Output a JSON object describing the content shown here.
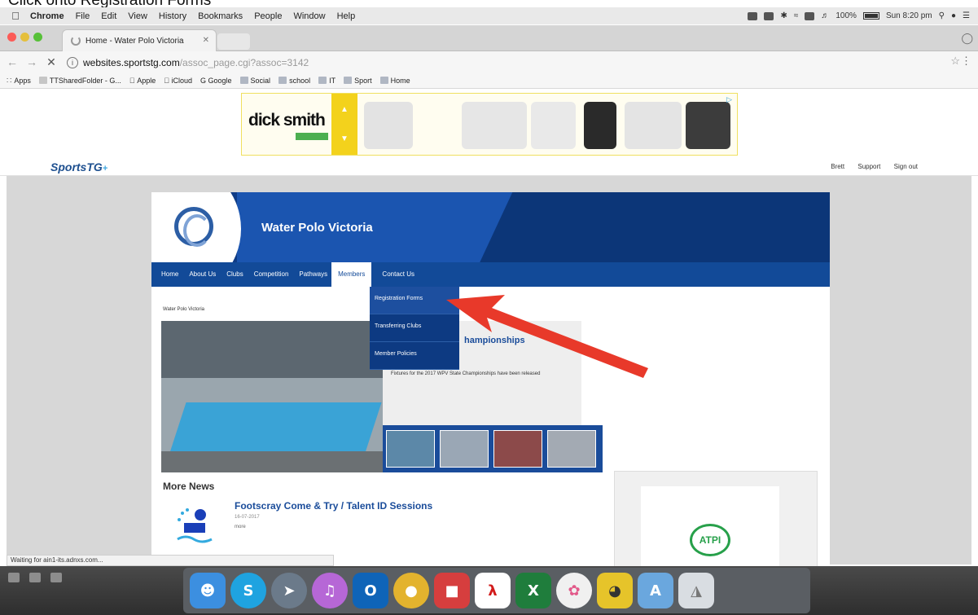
{
  "caption": "Click onto Registration Forms",
  "menubar": {
    "items": [
      "Chrome",
      "File",
      "Edit",
      "View",
      "History",
      "Bookmarks",
      "People",
      "Window",
      "Help"
    ],
    "battery": "100%",
    "clock": "Sun 8:20 pm"
  },
  "browser": {
    "tab_title": "Home - Water Polo Victoria",
    "url_host": "websites.sportstg.com",
    "url_path": "/assoc_page.cgi?assoc=3142",
    "bookmarks": [
      "Apps",
      "TTSharedFolder - G...",
      "Apple",
      "iCloud",
      "Google",
      "Social",
      "school",
      "IT",
      "Sport",
      "Home"
    ],
    "status": "Waiting for ain1-its.adnxs.com..."
  },
  "ad": {
    "brand": "dick smith",
    "brand_sub": ".com.au"
  },
  "site": {
    "brand": "SportsTG",
    "user_links": [
      "Brett",
      "Support",
      "Sign out"
    ],
    "title": "Water Polo Victoria",
    "nav": [
      "Home",
      "About Us",
      "Clubs",
      "Competition",
      "Pathways",
      "Members",
      "Contact Us"
    ],
    "dropdown": [
      "Registration Forms",
      "Transferring Clubs",
      "Member Policies"
    ],
    "breadcrumb": "Water Polo Victoria",
    "featured_title": "hampionships",
    "featured_text": "Fixtures for the 2017 WPV State Championships have been released",
    "more_news": "More News",
    "news_title": "Footscray Come & Try / Talent ID Sessions",
    "news_date": "16-07-2017",
    "news_more": "more",
    "sponsor": "ATPI"
  },
  "colors": {
    "nav_blue": "#124a98",
    "banner_blue": "#0f3c86",
    "link_blue": "#1a4c9a",
    "arrow_red": "#e8392a"
  }
}
